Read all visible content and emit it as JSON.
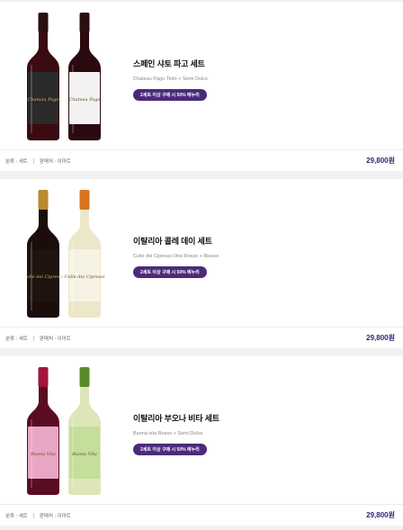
{
  "products": [
    {
      "title": "스페인 샤토 파고 세트",
      "subtitle": "Chateau Pago Tinto + Semi Dulce",
      "promo": "2세트 이상 구매 시 50% 에누리",
      "category": "분류 : 세트",
      "seller": "판매처 : 이마트",
      "price": "29,800원",
      "bottle_colors": [
        "#3a0b10",
        "#2a0a0e"
      ],
      "label_colors": [
        "#2a2a2a",
        "#f2f2f2"
      ],
      "cap_colors": [
        "#2a0f12",
        "#2a0f12"
      ],
      "label_text": [
        "Chateau Pago",
        "Chateau Pago"
      ]
    },
    {
      "title": "이탈리아 콜레 데이 세트",
      "subtitle": "Colle dei Cipressi Vino Rosso + Bianco",
      "promo": "2세트 이상 구매 시 50% 에누리",
      "category": "분류 : 세트",
      "seller": "판매처 : 이마트",
      "price": "29,800원",
      "bottle_colors": [
        "#1a0d0a",
        "#ede7c9"
      ],
      "label_colors": [
        "#1e130e",
        "#f7f3e4"
      ],
      "cap_colors": [
        "#b98a2e",
        "#d9741f"
      ],
      "label_text": [
        "Colle dei Cipressi",
        "Colle dei Cipressi"
      ]
    },
    {
      "title": "이탈리아 부오나 비타 세트",
      "subtitle": "Buona vita Rosso + Semi Dulce",
      "promo": "2세트 이상 구매 시 50% 에누리",
      "category": "분류 : 세트",
      "seller": "판매처 : 이마트",
      "price": "29,800원",
      "bottle_colors": [
        "#5a0c22",
        "#dde6b8"
      ],
      "label_colors": [
        "#e9a6c4",
        "#c4de9c"
      ],
      "cap_colors": [
        "#a3143e",
        "#5c8a2a"
      ],
      "label_text": [
        "Buona Vita",
        "Buona Vita"
      ]
    }
  ]
}
